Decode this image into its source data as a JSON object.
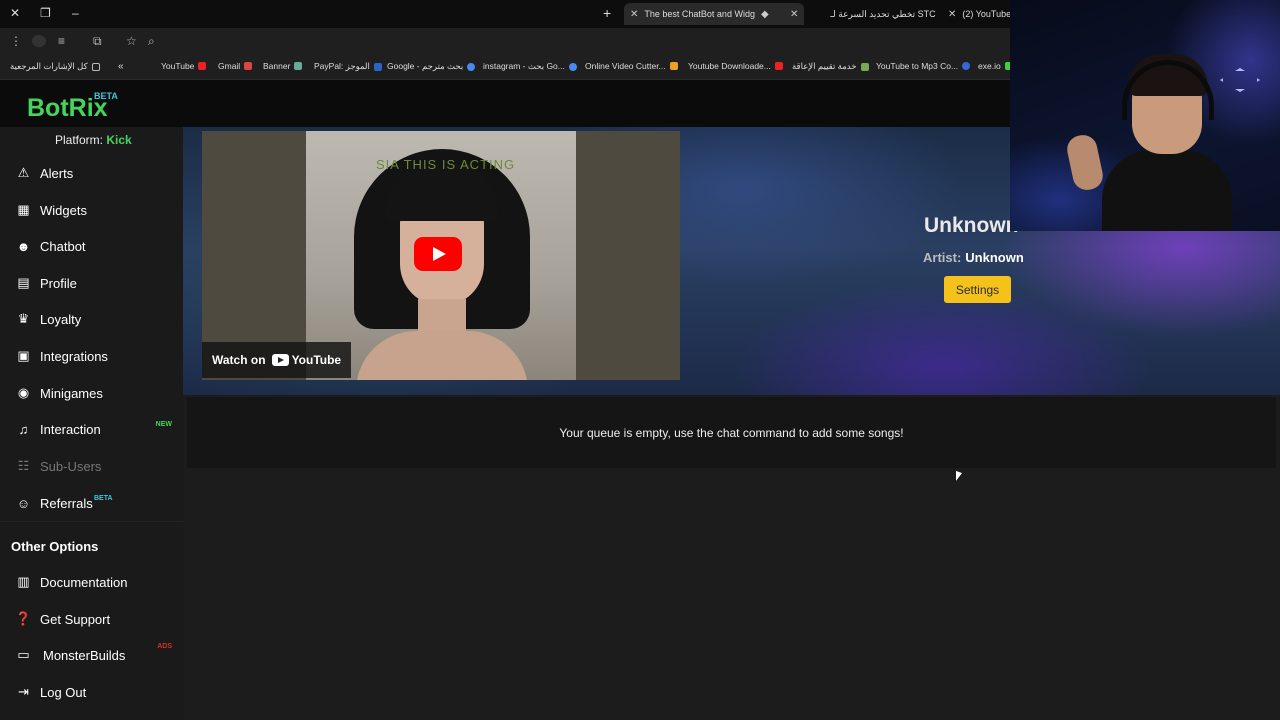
{
  "browser": {
    "tabs": [
      {
        "title": "The best ChatBot and Widg",
        "active": true
      },
      {
        "title": "تخطي تحديد السرعة لـ STC",
        "active": false
      },
      {
        "title": "(2) YouTube",
        "active": false
      }
    ],
    "bookmarks": [
      "كل الإشارات المرجعية",
      "YouTube",
      "Gmail",
      "Banner",
      "PayPal: الموجز",
      "Google - بحث مترجم",
      "instagram - بحث Go...",
      "Online Video Cutter...",
      "Youtube Downloade...",
      "خدمة تقييم الإعاقة",
      "YouTube to Mp3 Co...",
      "exe.io"
    ]
  },
  "app": {
    "logo": "BotRix",
    "logo_badge": "BETA",
    "platform_label": "Platform:",
    "platform_value": "Kick"
  },
  "sidebar": {
    "items": [
      {
        "label": "Alerts",
        "icon": "warning-icon"
      },
      {
        "label": "Widgets",
        "icon": "grid-icon"
      },
      {
        "label": "Chatbot",
        "icon": "robot-icon"
      },
      {
        "label": "Profile",
        "icon": "id-card-icon"
      },
      {
        "label": "Loyalty",
        "icon": "trophy-icon"
      },
      {
        "label": "Integrations",
        "icon": "plug-icon"
      },
      {
        "label": "Minigames",
        "icon": "gamepad-icon"
      },
      {
        "label": "Interaction",
        "icon": "music-note-icon",
        "badge": "NEW"
      },
      {
        "label": "Sub-Users",
        "icon": "users-icon",
        "disabled": true
      },
      {
        "label": "Referrals",
        "icon": "user-group-icon",
        "badge": "BETA"
      }
    ],
    "other_title": "Other Options",
    "other_items": [
      {
        "label": "Documentation",
        "icon": "book-icon"
      },
      {
        "label": "Get Support",
        "icon": "question-icon"
      },
      {
        "label": "MonsterBuilds",
        "icon": "laptop-icon",
        "badge": "ADS"
      },
      {
        "label": "Log Out",
        "icon": "logout-icon"
      }
    ]
  },
  "player": {
    "video_watch_label": "Watch on",
    "video_brand": "YouTube",
    "art_text": "SIA THIS IS ACTING",
    "song_title": "Unknown",
    "artist_label": "Artist:",
    "artist_value": "Unknown",
    "settings_label": "Settings"
  },
  "queue": {
    "empty_message": "Your queue is empty, use the chat command to add some songs!"
  },
  "colors": {
    "brand_green": "#45d45e",
    "beta_blue": "#3ec6e0",
    "settings_yellow": "#f4c21b",
    "youtube_red": "#ff0000"
  }
}
